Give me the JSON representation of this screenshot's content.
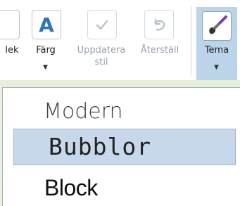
{
  "ribbon": {
    "buttons": [
      {
        "label": "lek"
      },
      {
        "label": "Färg"
      },
      {
        "label": "Uppdatera\nstil"
      },
      {
        "label": "Återställ"
      },
      {
        "label": "Tema"
      }
    ]
  },
  "theme_menu": {
    "items": [
      {
        "label": "Modern",
        "selected": false
      },
      {
        "label": "Bubblor",
        "selected": true
      },
      {
        "label": "Block",
        "selected": false
      }
    ]
  },
  "colors": {
    "selection_bg": "#c7d8ea",
    "accent_blue": "#2e75c0",
    "background": "#e8f0e0"
  },
  "icons": [
    "font-color-a-icon",
    "checkmark-icon",
    "undo-icon",
    "paintbrush-icon",
    "chevron-down-icon"
  ]
}
